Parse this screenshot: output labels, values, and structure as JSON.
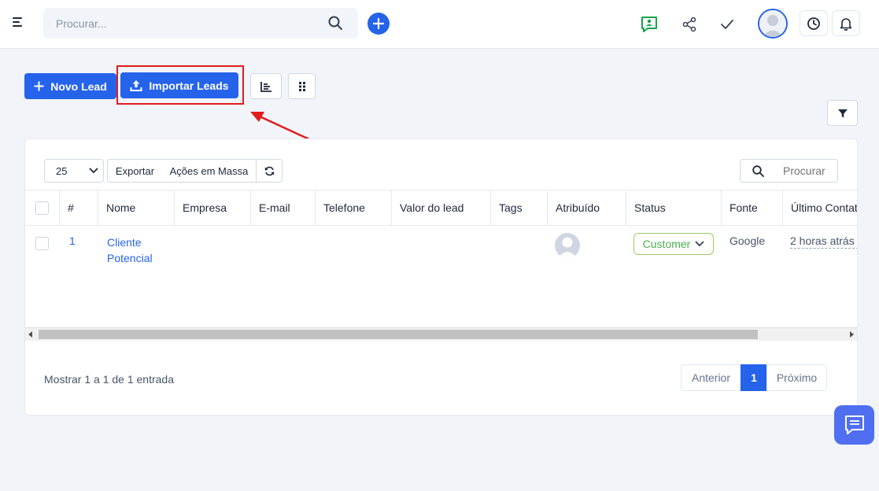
{
  "header": {
    "search_placeholder": "Procurar..."
  },
  "toolbar": {
    "new_lead": "Novo Lead",
    "import_leads": "Importar Leads"
  },
  "table_controls": {
    "page_size": "25",
    "page_size_options": [
      "25"
    ],
    "export": "Exportar",
    "bulk_actions": "Ações em Massa",
    "search_placeholder": "Procurar"
  },
  "columns": [
    "#",
    "Nome",
    "Empresa",
    "E-mail",
    "Telefone",
    "Valor do lead",
    "Tags",
    "Atribuído",
    "Status",
    "Fonte",
    "Último Contato"
  ],
  "rows": [
    {
      "id": "1",
      "name": "Cliente Potencial",
      "status": "Customer",
      "source": "Google",
      "last_contact": "2 horas atrás"
    }
  ],
  "footer": {
    "summary": "Mostrar 1 a 1 de 1 entrada",
    "prev": "Anterior",
    "page": "1",
    "next": "Próximo"
  },
  "colors": {
    "primary": "#2563eb",
    "highlight": "#e11d1d",
    "status_green": "#4caf50",
    "link_blue": "#2563eb",
    "chat_icon_green": "#16a34a"
  }
}
